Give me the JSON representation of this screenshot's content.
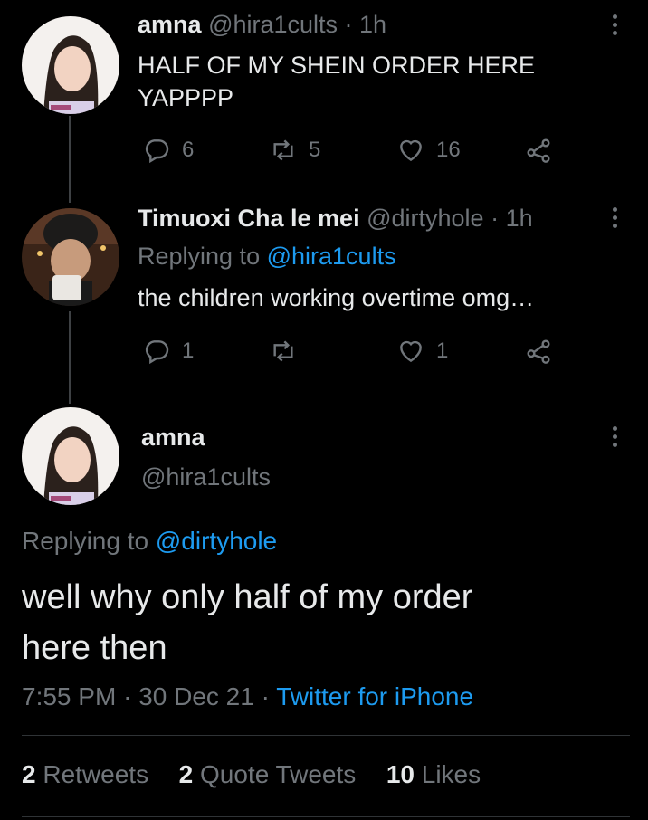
{
  "tweets": [
    {
      "display_name": "amna",
      "handle": "@hira1cults",
      "time": "· 1h",
      "text_line1": "HALF OF MY SHEIN ORDER HERE",
      "text_line2": "YAPPPP",
      "replies": "6",
      "retweets": "5",
      "likes": "16"
    },
    {
      "display_name": "Timuoxi Cha le mei",
      "handle": "@dirtyhole",
      "time": "· 1h",
      "replying_prefix": "Replying to",
      "replying_to": "@hira1cults",
      "text": "the children working overtime omg…",
      "replies": "1",
      "retweets": "",
      "likes": "1"
    }
  ],
  "main": {
    "display_name": "amna",
    "handle": "@hira1cults",
    "replying_prefix": "Replying to",
    "replying_to": "@dirtyhole",
    "text_line1": "well why only half of my order",
    "text_line2": "here then",
    "time": "7:55 PM",
    "sep1": "·",
    "date": "30 Dec 21",
    "sep2": "·",
    "source": "Twitter for iPhone",
    "retweets_count": "2",
    "retweets_label": "Retweets",
    "quotes_count": "2",
    "quotes_label": "Quote Tweets",
    "likes_count": "10",
    "likes_label": "Likes"
  },
  "icons": [
    "reply-icon",
    "retweet-icon",
    "like-icon",
    "share-icon",
    "more-icon"
  ]
}
